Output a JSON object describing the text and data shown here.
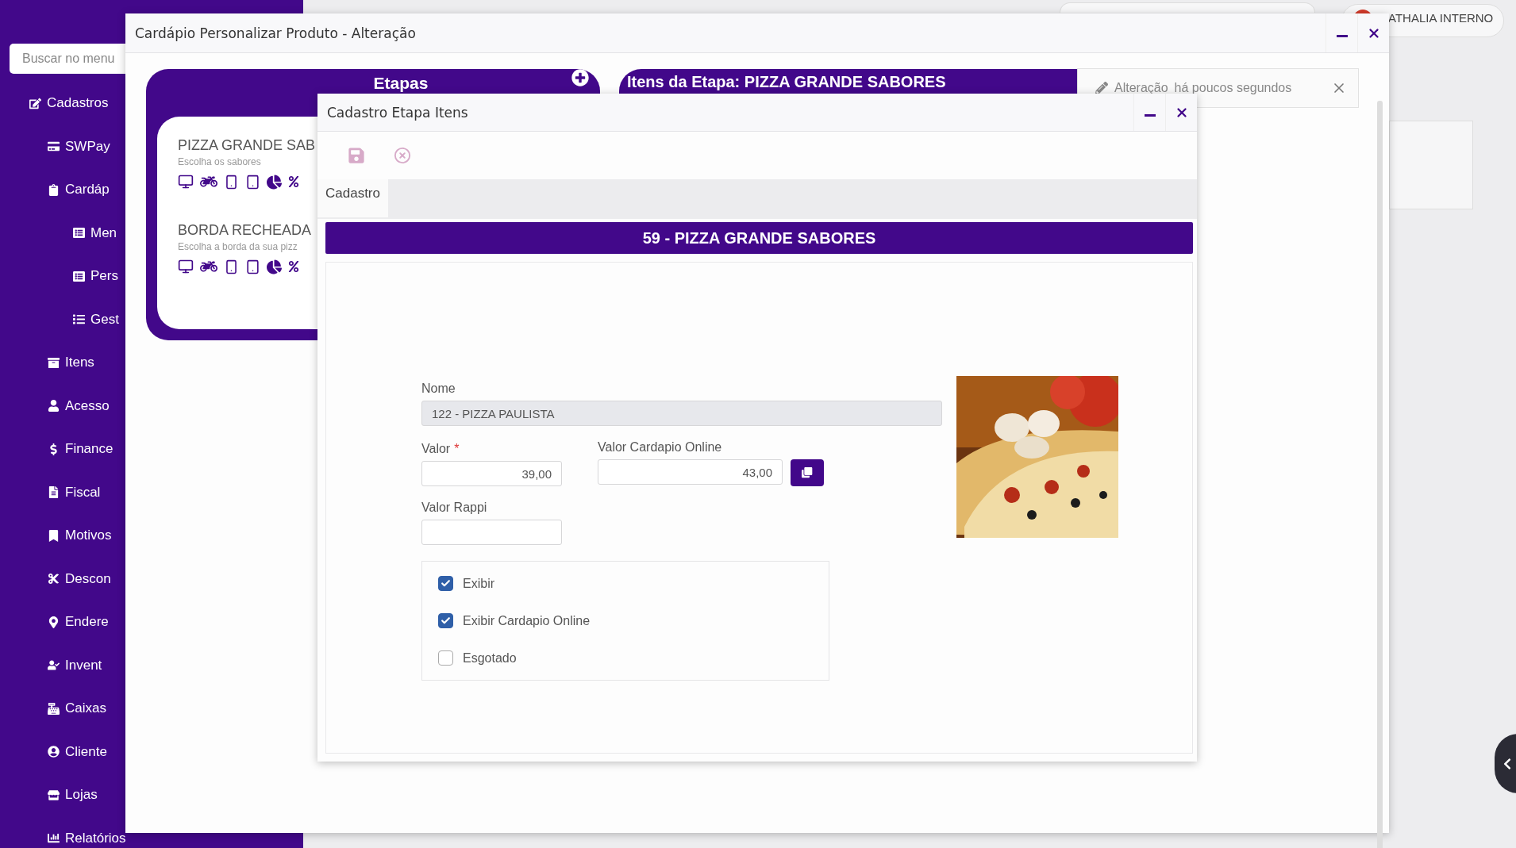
{
  "sidebar": {
    "search": {
      "placeholder": "Buscar no menu"
    },
    "items": [
      {
        "label": "Cadastros",
        "children": [
          {
            "label": "SWPay"
          },
          {
            "label": "Cardáp",
            "children": [
              {
                "label": "Men"
              },
              {
                "label": "Pers"
              },
              {
                "label": "Gest"
              }
            ]
          },
          {
            "label": "Itens"
          },
          {
            "label": "Acesso"
          },
          {
            "label": "Finance"
          },
          {
            "label": "Fiscal"
          },
          {
            "label": "Motivos"
          },
          {
            "label": "Descon"
          },
          {
            "label": "Endere"
          },
          {
            "label": "Invent"
          },
          {
            "label": "Caixas"
          },
          {
            "label": "Cliente"
          },
          {
            "label": "Lojas"
          },
          {
            "label": "Relatórios"
          }
        ]
      }
    ]
  },
  "user": {
    "name": "ATHALIA INTERNO"
  },
  "main_window": {
    "title": "Cardápio Personalizar Produto - Alteração",
    "etapas": {
      "title": "Etapas",
      "items": [
        {
          "title": "PIZZA GRANDE SAB",
          "subtitle": "Escolha os sabores"
        },
        {
          "title": "BORDA RECHEADA",
          "subtitle": "Escolha a borda da sua pizz"
        }
      ]
    },
    "itens_header": "Itens da Etapa: PIZZA GRANDE SABORES"
  },
  "toast": {
    "action": "Alteração",
    "time": "há poucos segundos"
  },
  "dialog": {
    "title": "Cadastro Etapa Itens",
    "tabs": [
      {
        "label": "Cadastro",
        "selected": true
      }
    ],
    "banner": "59 - PIZZA GRANDE SABORES",
    "fields": {
      "nome": {
        "label": "Nome",
        "value": "122 - PIZZA PAULISTA"
      },
      "valor": {
        "label": "Valor",
        "required_mark": "*",
        "value": "39,00"
      },
      "valor_online": {
        "label": "Valor Cardapio Online",
        "value": "43,00"
      },
      "valor_rappi": {
        "label": "Valor Rappi"
      }
    },
    "options": [
      {
        "label": "Exibir",
        "checked": true
      },
      {
        "label": "Exibir Cardapio Online",
        "checked": true
      },
      {
        "label": "Esgotado",
        "checked": false
      }
    ]
  }
}
